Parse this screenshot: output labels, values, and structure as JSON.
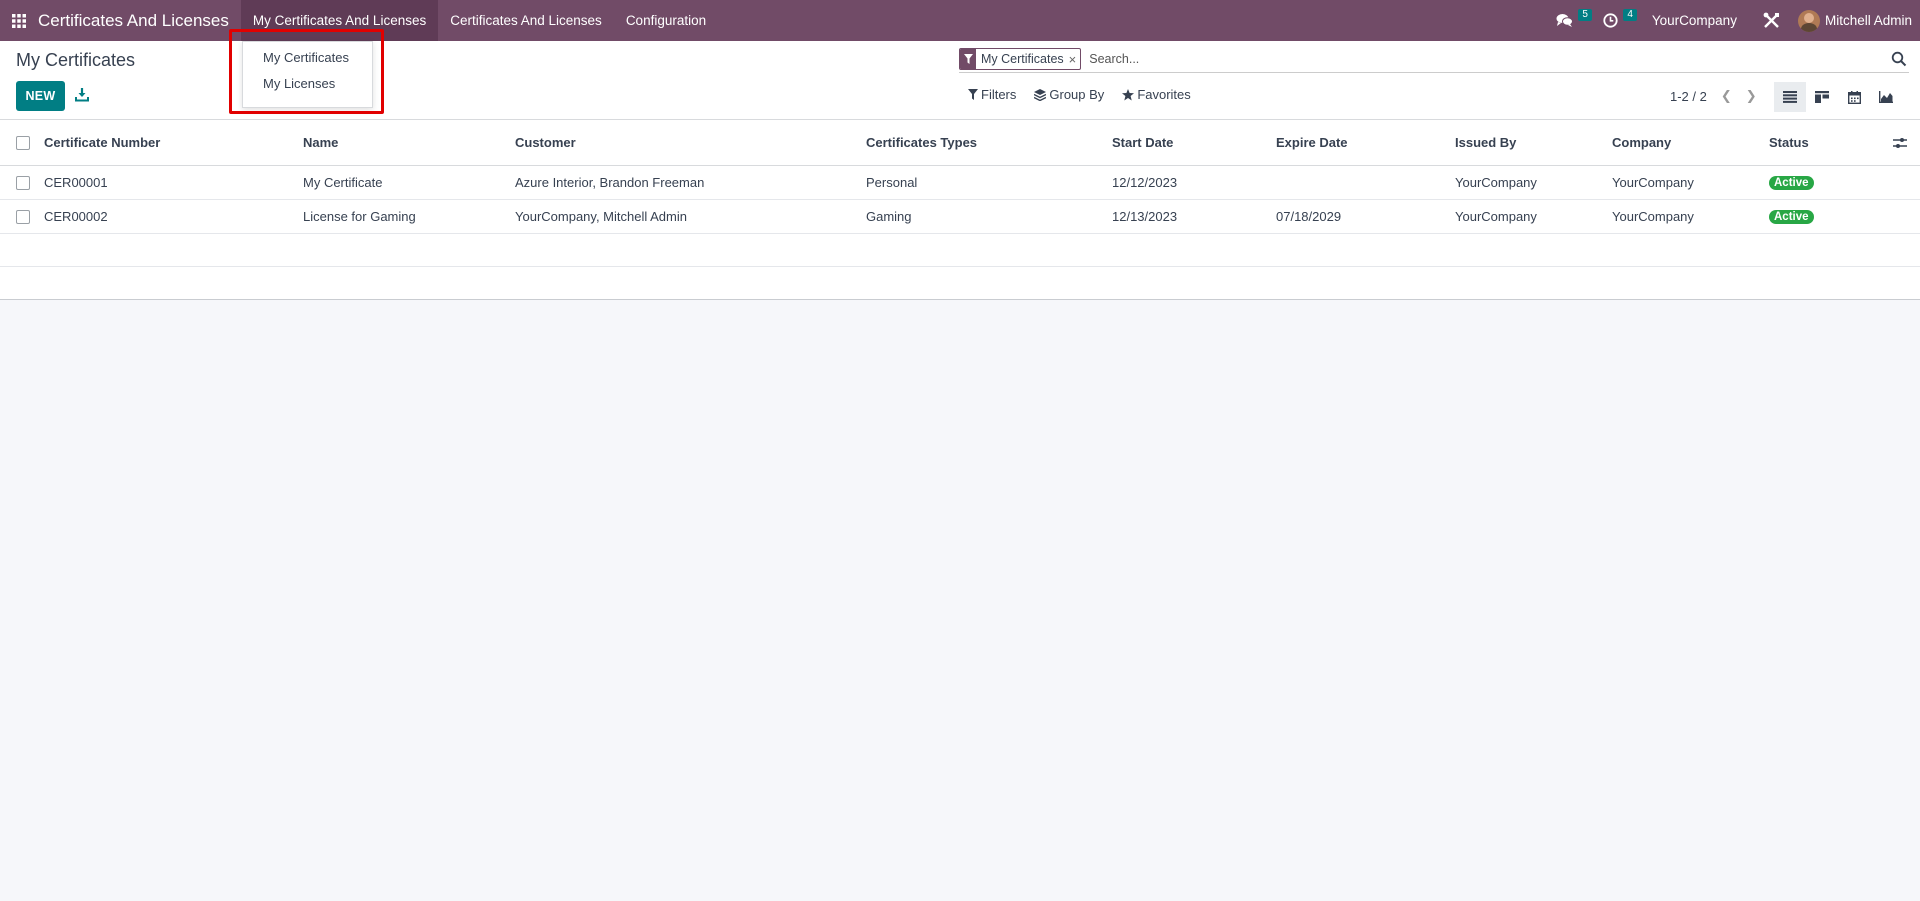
{
  "navbar": {
    "brand": "Certificates And Licenses",
    "menu": [
      "My Certificates And Licenses",
      "Certificates And Licenses",
      "Configuration"
    ],
    "messages_badge": "5",
    "activities_badge": "4",
    "company": "YourCompany",
    "user": "Mitchell Admin"
  },
  "dropdown": {
    "items": [
      "My Certificates",
      "My Licenses"
    ]
  },
  "control_panel": {
    "title": "My Certificates",
    "new_label": "NEW",
    "facet_label": "My Certificates",
    "facet_close": "×",
    "search_placeholder": "Search...",
    "filters_label": "Filters",
    "groupby_label": "Group By",
    "favorites_label": "Favorites",
    "pager": "1-2 / 2"
  },
  "table": {
    "columns": [
      "Certificate Number",
      "Name",
      "Customer",
      "Certificates Types",
      "Start Date",
      "Expire Date",
      "Issued By",
      "Company",
      "Status"
    ],
    "rows": [
      [
        "CER00001",
        "My Certificate",
        "Azure Interior, Brandon Freeman",
        "Personal",
        "12/12/2023",
        "",
        "YourCompany",
        "YourCompany",
        "Active"
      ],
      [
        "CER00002",
        "License for Gaming",
        "YourCompany, Mitchell Admin",
        "Gaming",
        "12/13/2023",
        "07/18/2029",
        "YourCompany",
        "YourCompany",
        "Active"
      ]
    ]
  },
  "colors": {
    "brand": "#714b67",
    "primary": "#017e84",
    "status_active": "#28a745",
    "highlight": "#e10000"
  }
}
